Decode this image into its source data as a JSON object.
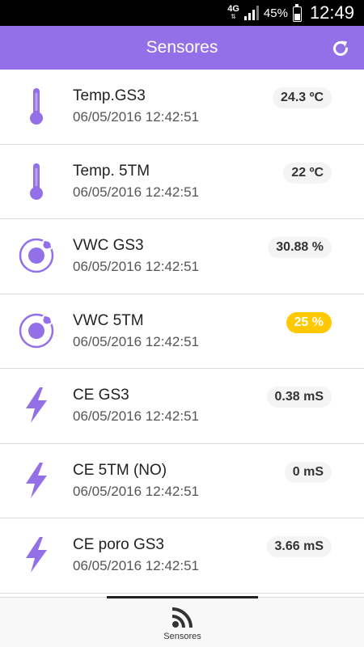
{
  "status_bar": {
    "network": "4G",
    "battery": "45%",
    "battery_level": 0.45,
    "time": "12:49"
  },
  "header": {
    "title": "Sensores",
    "refresh_icon": "refresh-icon"
  },
  "colors": {
    "accent": "#9470e8",
    "badge_default": "#f4f4f4",
    "badge_warning": "#ffc800"
  },
  "sensors": [
    {
      "name": "Temp.GS3",
      "timestamp": "06/05/2016 12:42:51",
      "value": "24.3 ºC",
      "icon": "thermometer-icon",
      "status": "normal"
    },
    {
      "name": "Temp. 5TM",
      "timestamp": "06/05/2016 12:42:51",
      "value": "22 ºC",
      "icon": "thermometer-icon",
      "status": "normal"
    },
    {
      "name": "VWC GS3",
      "timestamp": "06/05/2016 12:42:51",
      "value": "30.88 %",
      "icon": "ionic-icon",
      "status": "normal"
    },
    {
      "name": "VWC 5TM",
      "timestamp": "06/05/2016 12:42:51",
      "value": "25 %",
      "icon": "ionic-icon",
      "status": "warning"
    },
    {
      "name": "CE GS3",
      "timestamp": "06/05/2016 12:42:51",
      "value": "0.38 mS",
      "icon": "flash-icon",
      "status": "normal"
    },
    {
      "name": "CE 5TM (NO)",
      "timestamp": "06/05/2016 12:42:51",
      "value": "0 mS",
      "icon": "flash-icon",
      "status": "normal"
    },
    {
      "name": "CE poro GS3",
      "timestamp": "06/05/2016 12:42:51",
      "value": "3.66 mS",
      "icon": "flash-icon",
      "status": "normal"
    }
  ],
  "tabs": [
    {
      "label": "Sensores",
      "icon": "rss-icon",
      "active": true
    }
  ]
}
